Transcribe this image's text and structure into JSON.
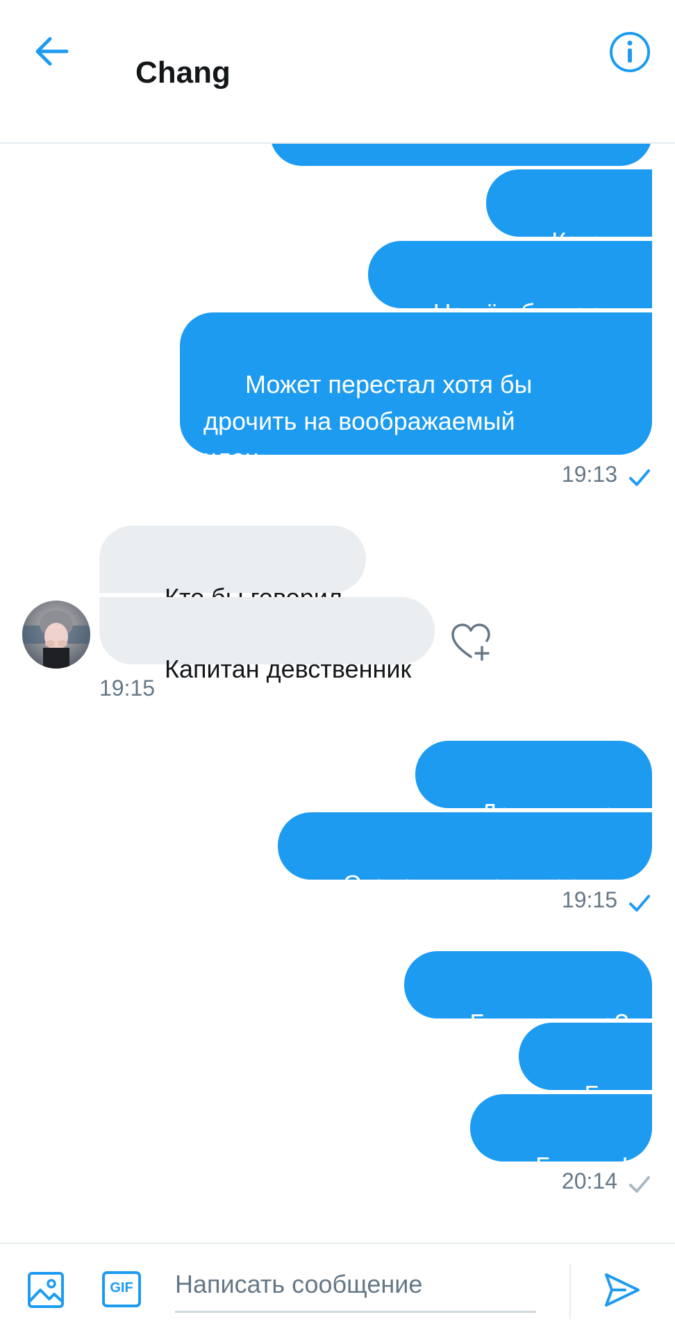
{
  "header": {
    "title": "Chang",
    "back_icon": "arrow-left-icon",
    "info_icon": "info-circle-icon"
  },
  "colors": {
    "accent": "#1d9bf0",
    "incoming_bubble": "#ebeef0",
    "muted_text": "#657786"
  },
  "messages": [
    {
      "direction": "out",
      "text": ""
    },
    {
      "direction": "out",
      "text": "Кстати"
    },
    {
      "direction": "out",
      "text": "Нашёл бы парня"
    },
    {
      "direction": "out",
      "text": "Может перестал хотя бы\nдрочить на воображаемый\nчлен"
    },
    {
      "direction": "in",
      "text": "Кто бы говорил"
    },
    {
      "direction": "in",
      "text": "Капитан девственник"
    },
    {
      "direction": "out",
      "text": "Дошутишься"
    },
    {
      "direction": "out",
      "text": "Станешь у меня первым"
    },
    {
      "direction": "out",
      "text": "Бини, ты где?"
    },
    {
      "direction": "out",
      "text": "Бин"
    },
    {
      "direction": "out",
      "text": "Биииин!"
    }
  ],
  "timestamps": {
    "t1": "19:13",
    "t2": "19:15",
    "t3": "19:15",
    "t4": "20:14"
  },
  "composer": {
    "placeholder": "Написать сообщение",
    "value": "",
    "media_icon": "image-icon",
    "gif_label": "GIF",
    "send_icon": "send-icon"
  }
}
